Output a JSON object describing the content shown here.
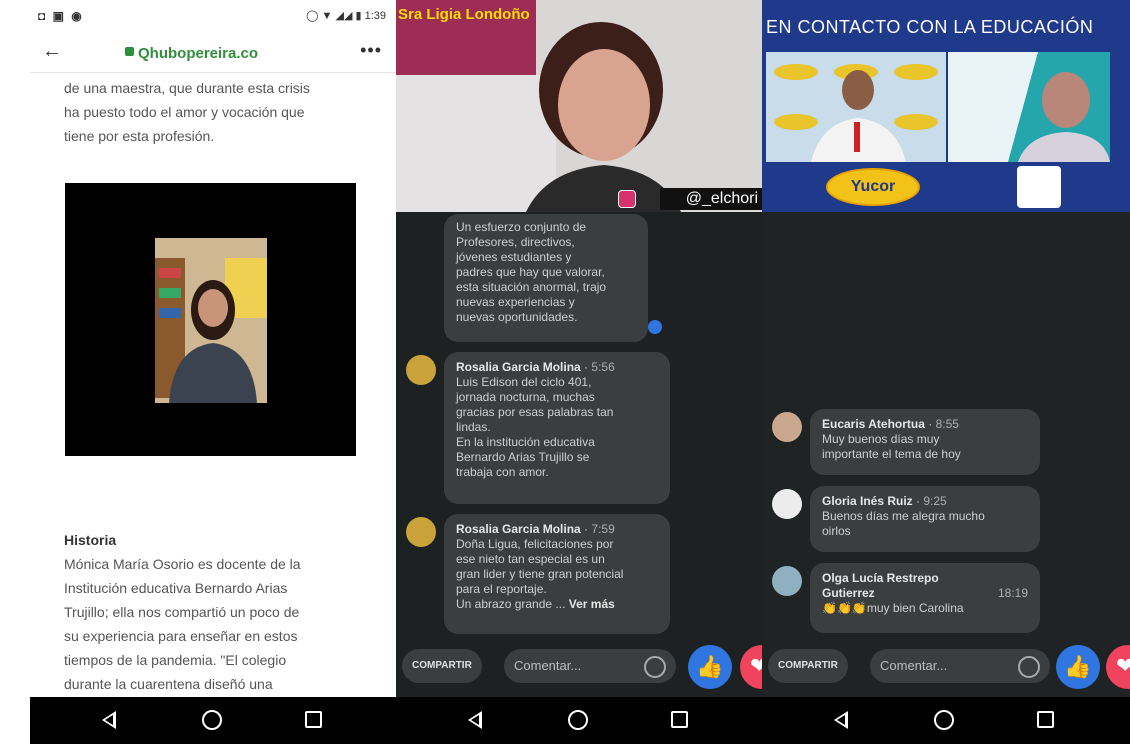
{
  "phone1": {
    "status_left": "◘ ▣ ◉",
    "status_right": "1:39",
    "url": "Qhubopereira.co",
    "menu": "•••",
    "intro_lines": [
      "de una maestra, que durante esta crisis",
      "ha puesto todo el amor y vocación que",
      "tiene por esta profesión."
    ],
    "history_title": "Historia",
    "history_lines": [
      "Mónica María Osorio es docente de la",
      "Institución educativa Bernardo Arias",
      "Trujillo; ella nos compartió un poco de",
      "su experiencia para enseñar en estos",
      "tiempos de la pandemia. \"El colegio",
      "durante la cuarentena diseñó una"
    ]
  },
  "phone2": {
    "live_name": "Sra Ligia Londoño",
    "handle": "@_elchori",
    "comments": [
      {
        "author": "",
        "time": "",
        "lines": [
          "Un esfuerzo conjunto de",
          "Profesores, directivos,",
          "jóvenes estudiantes y",
          "padres que hay que valorar,",
          "esta situación anormal, trajo",
          "nuevas experiencias y",
          "nuevas oportunidades."
        ]
      },
      {
        "author": "Rosalia Garcia Molina",
        "time": "5:56",
        "lines": [
          "Luis Edison del ciclo 401,",
          "jornada nocturna, muchas",
          "gracias por esas palabras tan",
          "lindas.",
          "En la institución educativa",
          "Bernardo Arias Trujillo se",
          "trabaja con amor."
        ]
      },
      {
        "author": "Rosalia Garcia Molina",
        "time": "7:59",
        "lines": [
          "Doña Ligua, felicitaciones por",
          "ese nieto tan especial es un",
          "gran lider y tiene gran potencial",
          "para el reportaje.",
          "Un abrazo grande ..."
        ],
        "more": "Ver más"
      }
    ],
    "share": "COMPARTIR",
    "comment_placeholder": "Comentar..."
  },
  "phone3": {
    "header": "EN CONTACTO CON LA EDUCACIÓN",
    "logo": "Yucor",
    "comments": [
      {
        "author": "Eucaris Atehortua",
        "time": "8:55",
        "lines": [
          "Muy buenos días  muy",
          "importante  el tema de hoy"
        ]
      },
      {
        "author": "Gloria Inés Ruiz",
        "time": "9:25",
        "lines": [
          "Buenos días   me alegra mucho",
          "oirlos"
        ]
      },
      {
        "author": "Olga Lucía Restrepo",
        "author2": "Gutierrez",
        "time": "18:19",
        "lines": [
          "👏👏👏muy bien Carolina"
        ]
      }
    ],
    "share": "COMPARTIR",
    "comment_placeholder": "Comentar..."
  },
  "colors": {
    "accent_blue": "#2f76e0",
    "heart_red": "#f0445e",
    "url_green": "#2f8f3c"
  }
}
